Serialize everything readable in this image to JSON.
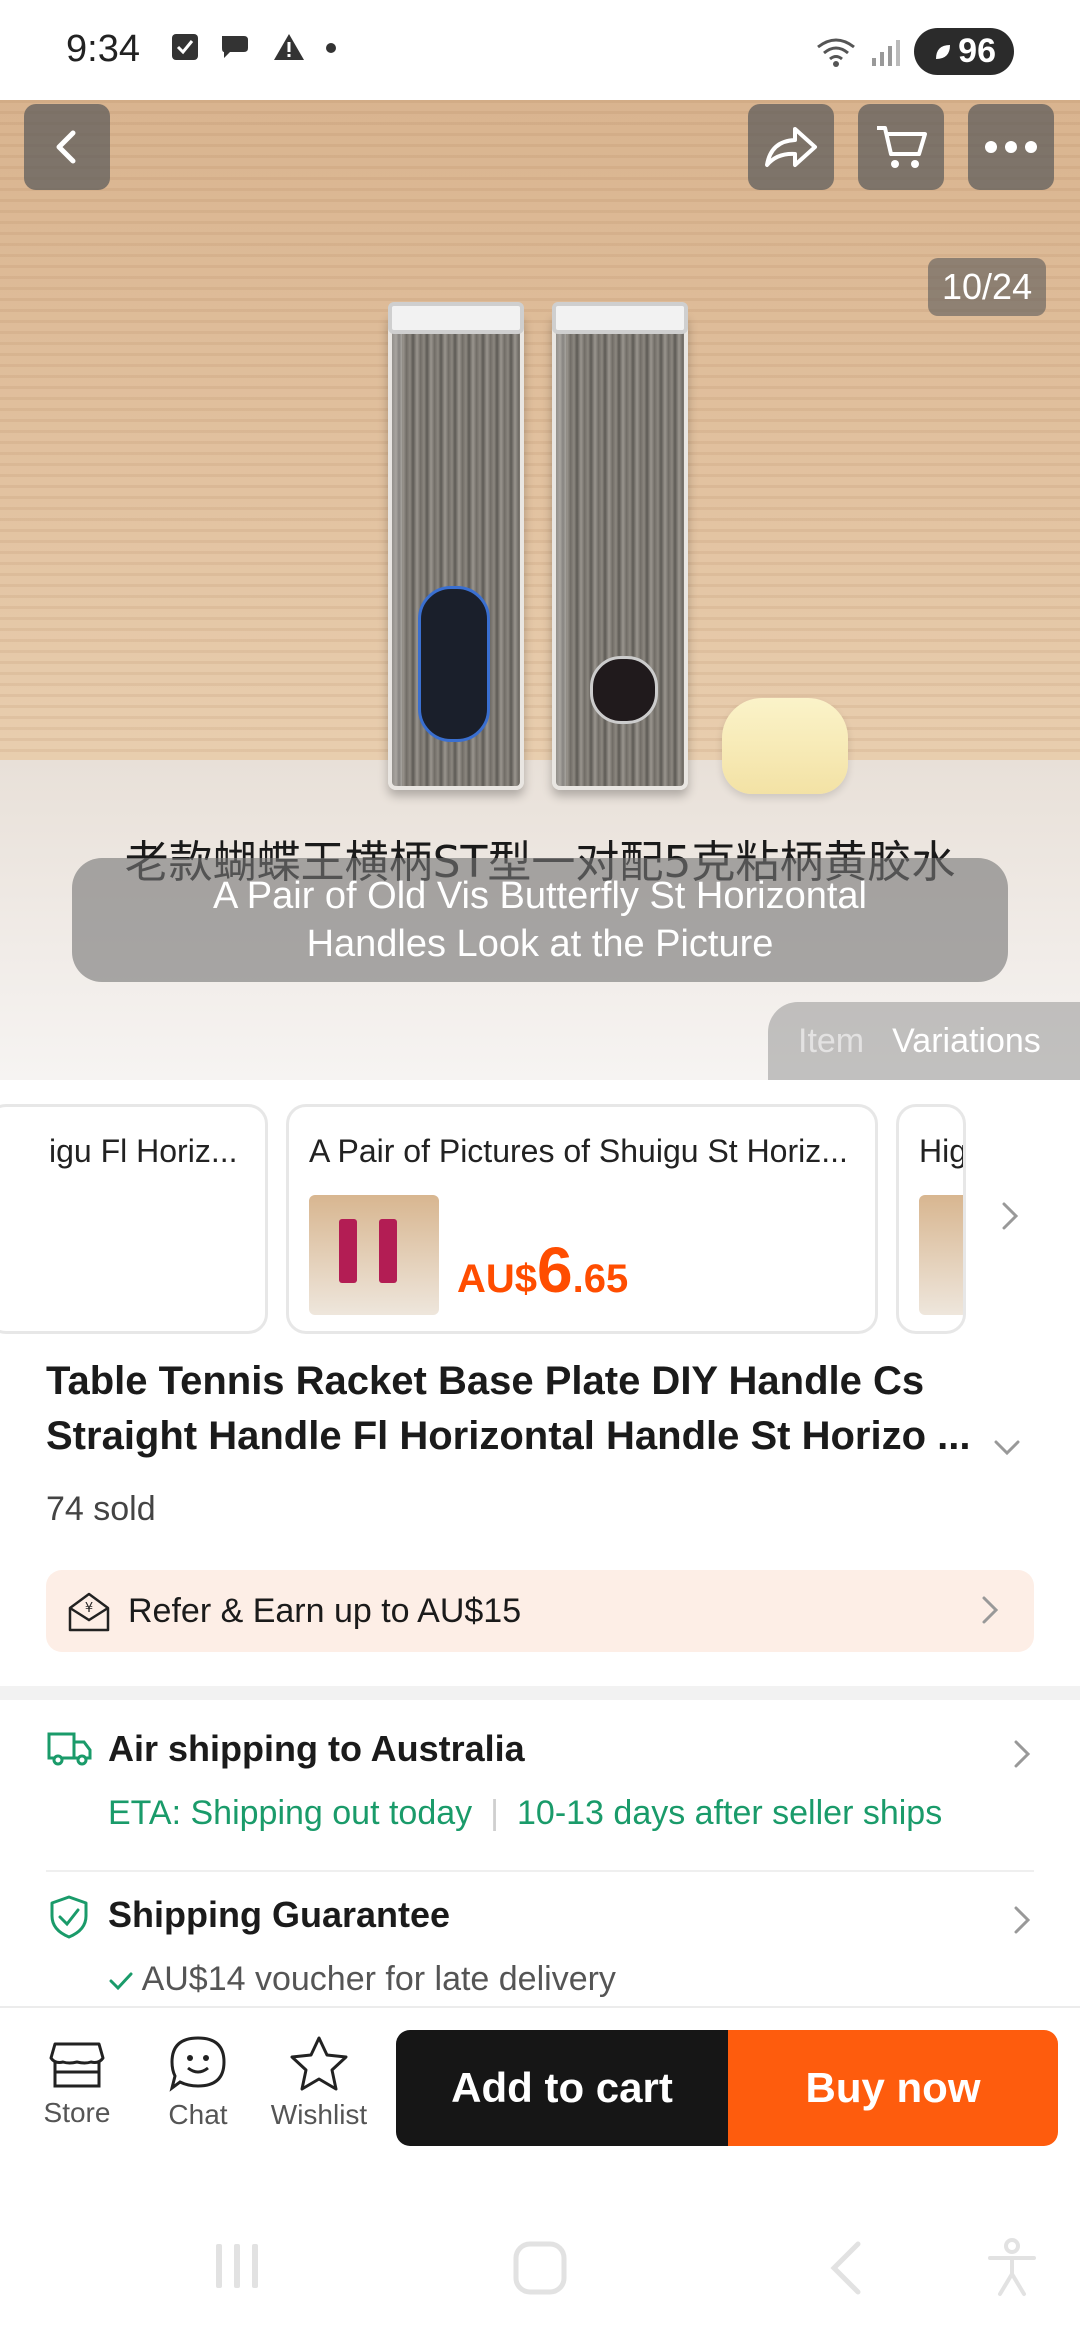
{
  "status_bar": {
    "time": "9:34",
    "battery": "96"
  },
  "hero": {
    "image_counter": "10/24",
    "caption_chinese": "老款蝴蝶王横柄ST型一对配5克粘柄黄胶水",
    "caption_translation": "A Pair of Old Vis Butterfly St Horizontal Handles Look at the Picture",
    "tabs": {
      "item": "Item",
      "variations": "Variations"
    }
  },
  "variations": [
    {
      "title": "igu Fl Horiz...",
      "price": null
    },
    {
      "title": "A Pair of Pictures of Shuigu St Horiz...",
      "currency": "AU$",
      "price_int": "6",
      "price_dec": ".65"
    },
    {
      "title": "Hig",
      "price": null
    }
  ],
  "product": {
    "title": "Table Tennis Racket Base Plate DIY Handle Cs Straight Handle Fl Horizontal Handle St Horizo ...",
    "sold": "74 sold"
  },
  "refer": {
    "label": "Refer & Earn up to AU$15"
  },
  "shipping": {
    "title": "Air shipping to Australia",
    "eta": "ETA: Shipping out today",
    "separator": "|",
    "after": "10-13 days after seller ships"
  },
  "guarantee": {
    "title": "Shipping Guarantee",
    "subtitle": "AU$14 voucher for late delivery"
  },
  "action_bar": {
    "store": "Store",
    "chat": "Chat",
    "wishlist": "Wishlist",
    "add_to_cart": "Add to cart",
    "buy_now": "Buy now"
  },
  "colors": {
    "accent_orange": "#fe5c0d",
    "price_orange": "#ff4d00",
    "shipping_green": "#1a9b6a",
    "cart_black": "#161616"
  }
}
